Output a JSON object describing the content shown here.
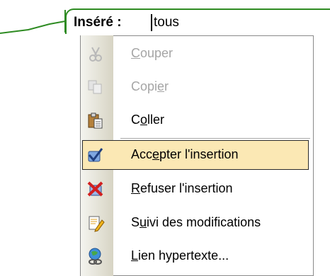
{
  "field": {
    "label": "Inséré :",
    "value": "tous"
  },
  "menu": {
    "items": [
      {
        "label": "Couper",
        "mnemonic_index": 0,
        "icon": "scissors-icon",
        "disabled": true
      },
      {
        "label": "Copier",
        "mnemonic_index": 4,
        "icon": "copy-icon",
        "disabled": true
      },
      {
        "label": "Coller",
        "mnemonic_index": 1,
        "icon": "paste-icon",
        "disabled": false
      },
      {
        "label": "Accepter l'insertion",
        "mnemonic_index": 3,
        "icon": "accept-change-icon",
        "disabled": false,
        "highlighted": true
      },
      {
        "label": "Refuser l'insertion",
        "mnemonic_index": 0,
        "icon": "reject-change-icon",
        "disabled": false
      },
      {
        "label": "Suivi des modifications",
        "mnemonic_index": 1,
        "icon": "track-changes-icon",
        "disabled": false
      },
      {
        "label": "Lien hypertexte...",
        "mnemonic_index": 0,
        "icon": "hyperlink-icon",
        "disabled": false
      }
    ]
  },
  "colors": {
    "connector": "#2e8b22",
    "highlight_bg": "#fbe8b4",
    "disabled_text": "#a5a5a5"
  }
}
